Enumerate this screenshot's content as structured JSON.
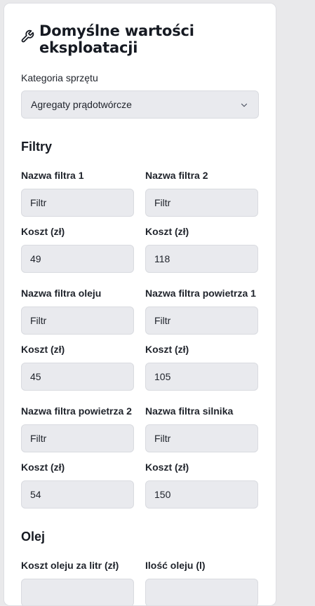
{
  "card": {
    "title_line1": "Domyślne wartości",
    "title_line2": "eksploatacji",
    "title_icon": "wrench-icon"
  },
  "category": {
    "label": "Kategoria sprzętu",
    "selected": "Agregaty prądotwórcze"
  },
  "filters": {
    "heading": "Filtry",
    "filter1_name_label": "Nazwa filtra 1",
    "filter1_name_value": "Filtr",
    "filter2_name_label": "Nazwa filtra 2",
    "filter2_name_value": "Filtr",
    "filter1_cost_label": "Koszt (zł)",
    "filter1_cost_value": "49",
    "filter2_cost_label": "Koszt (zł)",
    "filter2_cost_value": "118",
    "oil_filter_name_label": "Nazwa filtra oleju",
    "oil_filter_name_value": "Filtr",
    "air_filter1_name_label": "Nazwa filtra powietrza 1",
    "air_filter1_name_value": "Filtr",
    "oil_filter_cost_label": "Koszt (zł)",
    "oil_filter_cost_value": "45",
    "air_filter1_cost_label": "Koszt (zł)",
    "air_filter1_cost_value": "105",
    "air_filter2_name_label": "Nazwa filtra powietrza 2",
    "air_filter2_name_value": "Filtr",
    "engine_filter_name_label": "Nazwa filtra silnika",
    "engine_filter_name_value": "Filtr",
    "air_filter2_cost_label": "Koszt (zł)",
    "air_filter2_cost_value": "54",
    "engine_filter_cost_label": "Koszt (zł)",
    "engine_filter_cost_value": "150"
  },
  "oil": {
    "heading": "Olej",
    "cost_per_liter_label": "Koszt oleju za litr (zł)",
    "amount_label": "Ilość oleju (l)"
  },
  "colors": {
    "page_bg": "#e9e9eb",
    "card_bg": "#ffffff",
    "input_bg": "#e9eaee",
    "text": "#161a22"
  }
}
